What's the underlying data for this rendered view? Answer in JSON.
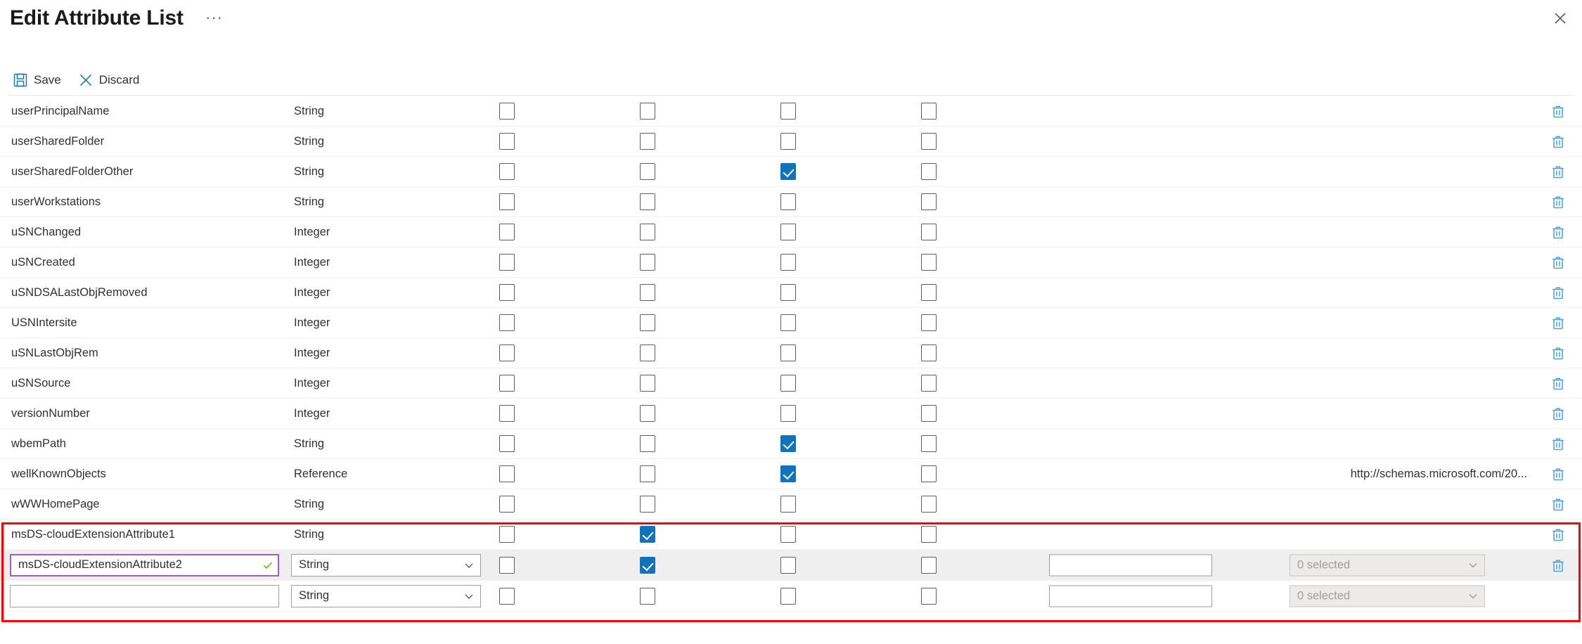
{
  "header": {
    "title": "Edit Attribute List",
    "more_label": "···",
    "close_icon": "close-icon"
  },
  "commandbar": {
    "save_label": "Save",
    "save_icon": "save-disk-icon",
    "discard_label": "Discard",
    "discard_icon": "discard-x-icon"
  },
  "colors": {
    "accent_blue": "#0f74bd",
    "trash_blue": "#4da2e0",
    "highlight_red": "#ff0000",
    "valid_border_purple": "#a05fc0",
    "valid_check_green": "#6bb700",
    "row_shaded": "#efefef"
  },
  "table": {
    "rows": [
      {
        "name": "userPrincipalName",
        "type": "String",
        "checks": [
          false,
          false,
          false,
          false
        ],
        "value": "",
        "editable": false,
        "shaded": false
      },
      {
        "name": "userSharedFolder",
        "type": "String",
        "checks": [
          false,
          false,
          false,
          false
        ],
        "value": "",
        "editable": false,
        "shaded": false
      },
      {
        "name": "userSharedFolderOther",
        "type": "String",
        "checks": [
          false,
          false,
          true,
          false
        ],
        "value": "",
        "editable": false,
        "shaded": false
      },
      {
        "name": "userWorkstations",
        "type": "String",
        "checks": [
          false,
          false,
          false,
          false
        ],
        "value": "",
        "editable": false,
        "shaded": false
      },
      {
        "name": "uSNChanged",
        "type": "Integer",
        "checks": [
          false,
          false,
          false,
          false
        ],
        "value": "",
        "editable": false,
        "shaded": false
      },
      {
        "name": "uSNCreated",
        "type": "Integer",
        "checks": [
          false,
          false,
          false,
          false
        ],
        "value": "",
        "editable": false,
        "shaded": false
      },
      {
        "name": "uSNDSALastObjRemoved",
        "type": "Integer",
        "checks": [
          false,
          false,
          false,
          false
        ],
        "value": "",
        "editable": false,
        "shaded": false
      },
      {
        "name": "USNIntersite",
        "type": "Integer",
        "checks": [
          false,
          false,
          false,
          false
        ],
        "value": "",
        "editable": false,
        "shaded": false
      },
      {
        "name": "uSNLastObjRem",
        "type": "Integer",
        "checks": [
          false,
          false,
          false,
          false
        ],
        "value": "",
        "editable": false,
        "shaded": false
      },
      {
        "name": "uSNSource",
        "type": "Integer",
        "checks": [
          false,
          false,
          false,
          false
        ],
        "value": "",
        "editable": false,
        "shaded": false
      },
      {
        "name": "versionNumber",
        "type": "Integer",
        "checks": [
          false,
          false,
          false,
          false
        ],
        "value": "",
        "editable": false,
        "shaded": false
      },
      {
        "name": "wbemPath",
        "type": "String",
        "checks": [
          false,
          false,
          true,
          false
        ],
        "value": "",
        "editable": false,
        "shaded": false
      },
      {
        "name": "wellKnownObjects",
        "type": "Reference",
        "checks": [
          false,
          false,
          true,
          false
        ],
        "value": "http://schemas.microsoft.com/20...",
        "editable": false,
        "shaded": false
      },
      {
        "name": "wWWHomePage",
        "type": "String",
        "checks": [
          false,
          false,
          false,
          false
        ],
        "value": "",
        "editable": false,
        "shaded": false
      },
      {
        "name": "msDS-cloudExtensionAttribute1",
        "type": "String",
        "checks": [
          false,
          true,
          false,
          false
        ],
        "value": "",
        "editable": false,
        "shaded": false
      }
    ],
    "edit_rows": [
      {
        "name_value": "msDS-cloudExtensionAttribute2",
        "name_placeholder": "",
        "name_valid": true,
        "type_value": "String",
        "type_disabled": false,
        "checks": [
          false,
          true,
          false,
          false
        ],
        "value_input": "",
        "value_placeholder": "",
        "selected_label": "0 selected",
        "selected_disabled": true,
        "has_trash": true,
        "shaded": true
      },
      {
        "name_value": "",
        "name_placeholder": "",
        "name_valid": false,
        "type_value": "String",
        "type_disabled": false,
        "checks": [
          false,
          false,
          false,
          false
        ],
        "value_input": "",
        "value_placeholder": "",
        "selected_label": "0 selected",
        "selected_disabled": true,
        "has_trash": false,
        "shaded": false
      }
    ]
  },
  "annotation": {
    "highlight_box": "red-highlight-box"
  }
}
